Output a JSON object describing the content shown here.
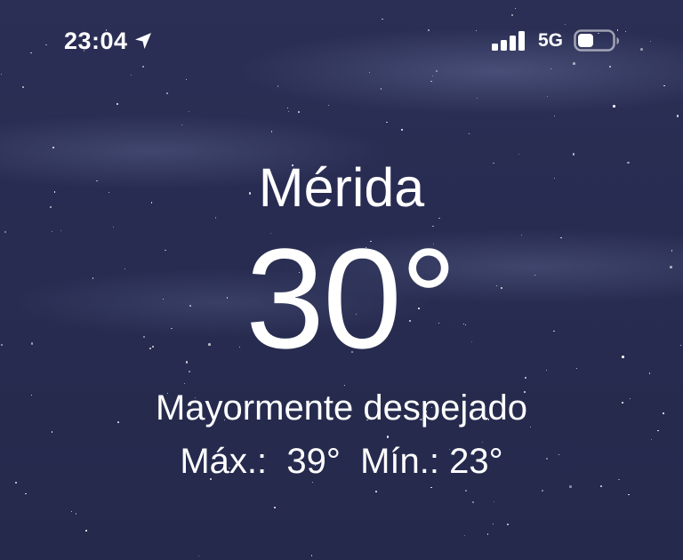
{
  "status_bar": {
    "time": "23:04",
    "location_icon": "location-arrow-icon",
    "signal_icon": "cellular-signal-icon",
    "network": "5G",
    "battery_icon": "battery-icon",
    "battery_level": 0.45
  },
  "weather": {
    "city": "Mérida",
    "temperature": "30°",
    "condition": "Mayormente despejado",
    "high_label": "Máx.:",
    "high_value": "39°",
    "low_label": "Mín.:",
    "low_value": "23°"
  },
  "colors": {
    "background": "#262a4f",
    "text": "#ffffff"
  }
}
